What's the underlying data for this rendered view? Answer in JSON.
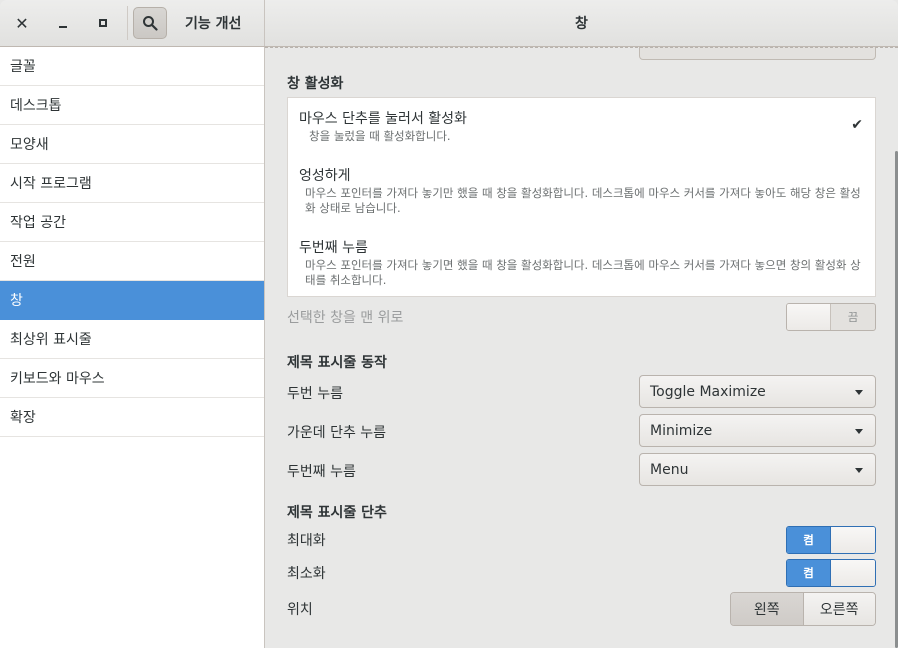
{
  "window": {
    "close_icon": "close-icon",
    "minimize_icon": "minimize-icon",
    "maximize_icon": "maximize-icon"
  },
  "header": {
    "left_title": "기능 개선",
    "main_title": "창",
    "search_icon": "search-icon"
  },
  "sidebar": {
    "items": [
      {
        "label": "글꼴"
      },
      {
        "label": "데스크톱"
      },
      {
        "label": "모양새"
      },
      {
        "label": "시작 프로그램"
      },
      {
        "label": "작업 공간"
      },
      {
        "label": "전원"
      },
      {
        "label": "창",
        "active": true
      },
      {
        "label": "최상위 표시줄"
      },
      {
        "label": "키보드와 마우스"
      },
      {
        "label": "확장"
      }
    ]
  },
  "main": {
    "activation": {
      "title": "창 활성화",
      "options": [
        {
          "label": "마우스 단추를 눌러서 활성화",
          "desc": "창을 눌렀을 때 활성화합니다.",
          "selected": true
        },
        {
          "label": "엉성하게",
          "desc": "마우스 포인터를 가져다 놓기만 했을 때 창을 활성화합니다. 데스크톱에 마우스 커서를 가져다 놓아도 해당 창은 활성화 상태로 남습니다."
        },
        {
          "label": "두번째 누름",
          "desc": "마우스 포인터를 가져다 놓기면 했을 때 창을 활성화합니다. 데스크톱에 마우스 커서를 가져다 놓으면 창의 활성화 상태를 취소합니다."
        }
      ],
      "check_icon": "checkmark-icon"
    },
    "raise_on_focus": {
      "label": "선택한 창을 맨 위로",
      "state_label": "끔",
      "on": false
    },
    "titlebar_actions": {
      "title": "제목 표시줄 동작",
      "rows": [
        {
          "label": "두번 누름",
          "value": "Toggle Maximize"
        },
        {
          "label": "가운데 단추 누름",
          "value": "Minimize"
        },
        {
          "label": "두번째 누름",
          "value": "Menu"
        }
      ]
    },
    "titlebar_buttons": {
      "title": "제목 표시줄 단추",
      "maximize": {
        "label": "최대화",
        "state_label": "켬",
        "on": true
      },
      "minimize": {
        "label": "최소화",
        "state_label": "켬",
        "on": true
      },
      "placement": {
        "label": "위치",
        "left": "왼쪽",
        "right": "오른쪽",
        "selected": "왼쪽"
      }
    }
  },
  "colors": {
    "accent": "#4a90d9",
    "background": "#e8e8e7"
  }
}
